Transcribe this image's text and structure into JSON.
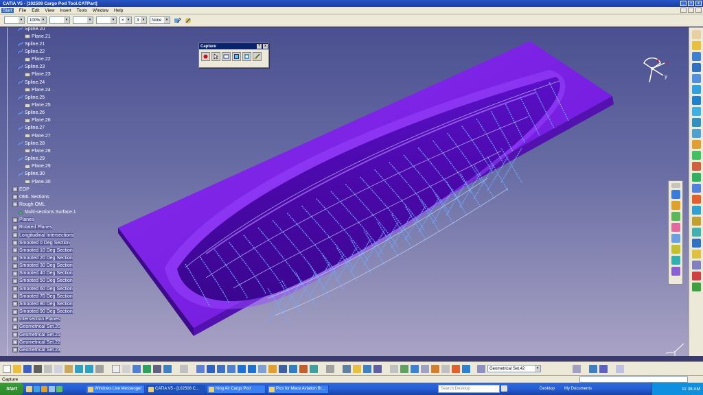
{
  "window": {
    "title": "CATIA V5 - [102508 Cargo Pod Tool.CATPart]"
  },
  "menu": [
    "Start",
    "File",
    "Edit",
    "View",
    "Insert",
    "Tools",
    "Window",
    "Help"
  ],
  "toolbar_top": {
    "zoom": "100%",
    "layer": "None",
    "thickness": "3"
  },
  "tree": [
    {
      "label": "Spline.20",
      "level": 2,
      "icon": "spline"
    },
    {
      "label": "Plane.21",
      "level": 3,
      "icon": "plane"
    },
    {
      "label": "Spline.21",
      "level": 2,
      "icon": "spline"
    },
    {
      "label": "Spline.22",
      "level": 2,
      "icon": "spline"
    },
    {
      "label": "Plane.22",
      "level": 3,
      "icon": "plane"
    },
    {
      "label": "Spline.23",
      "level": 2,
      "icon": "spline"
    },
    {
      "label": "Plane.23",
      "level": 3,
      "icon": "plane"
    },
    {
      "label": "Spline.24",
      "level": 2,
      "icon": "spline"
    },
    {
      "label": "Plane.24",
      "level": 3,
      "icon": "plane"
    },
    {
      "label": "Spline.25",
      "level": 2,
      "icon": "spline"
    },
    {
      "label": "Plane.25",
      "level": 3,
      "icon": "plane"
    },
    {
      "label": "Spline.26",
      "level": 2,
      "icon": "spline"
    },
    {
      "label": "Plane.26",
      "level": 3,
      "icon": "plane"
    },
    {
      "label": "Spline.27",
      "level": 2,
      "icon": "spline"
    },
    {
      "label": "Plane.27",
      "level": 3,
      "icon": "plane"
    },
    {
      "label": "Spline.28",
      "level": 2,
      "icon": "spline"
    },
    {
      "label": "Plane.28",
      "level": 3,
      "icon": "plane"
    },
    {
      "label": "Spline.29",
      "level": 2,
      "icon": "spline"
    },
    {
      "label": "Plane.29",
      "level": 3,
      "icon": "plane"
    },
    {
      "label": "Spline.30",
      "level": 2,
      "icon": "spline"
    },
    {
      "label": "Plane.30",
      "level": 3,
      "icon": "plane"
    },
    {
      "label": "EOP",
      "level": 1,
      "icon": "set"
    },
    {
      "label": "OML Sections",
      "level": 1,
      "icon": "set"
    },
    {
      "label": "Rough OML",
      "level": 1,
      "icon": "set"
    },
    {
      "label": "Multi-sections Surface.1",
      "level": 2,
      "icon": "surface"
    },
    {
      "label": "Planes",
      "level": 1,
      "icon": "set",
      "selected": true
    },
    {
      "label": "Rotated Planes",
      "level": 1,
      "icon": "set",
      "selected": true
    },
    {
      "label": "Longitudinal Intersections",
      "level": 1,
      "icon": "set",
      "selected": true
    },
    {
      "label": "Smooted 0 Deg Section",
      "level": 1,
      "icon": "set",
      "selected": true
    },
    {
      "label": "Smooted 10 Deg Section",
      "level": 1,
      "icon": "set",
      "selected": true
    },
    {
      "label": "Smooted 20 Deg Section",
      "level": 1,
      "icon": "set",
      "selected": true
    },
    {
      "label": "Smooted 30 Deg Section",
      "level": 1,
      "icon": "set",
      "selected": true
    },
    {
      "label": "Smooted 40 Deg Section",
      "level": 1,
      "icon": "set",
      "selected": true
    },
    {
      "label": "Smooted 50 Deg Section",
      "level": 1,
      "icon": "set",
      "selected": true
    },
    {
      "label": "Smooted 60 Deg Section",
      "level": 1,
      "icon": "set",
      "selected": true
    },
    {
      "label": "Smooted 70 Deg Section",
      "level": 1,
      "icon": "set",
      "selected": true
    },
    {
      "label": "Smooted 80 Deg Section",
      "level": 1,
      "icon": "set",
      "selected": true
    },
    {
      "label": "Smooted 90 Deg Section",
      "level": 1,
      "icon": "set",
      "selected": true
    },
    {
      "label": "Intersection Planes",
      "level": 1,
      "icon": "set",
      "selected": true
    },
    {
      "label": "Geometrical Set.20",
      "level": 1,
      "icon": "set",
      "selected": true
    },
    {
      "label": "Geometrical Set.21",
      "level": 1,
      "icon": "set",
      "selected": true
    },
    {
      "label": "Geometrical Set.22",
      "level": 1,
      "icon": "set",
      "selected": true
    },
    {
      "label": "Geometrical Set.23",
      "level": 1,
      "icon": "set",
      "selected": true
    }
  ],
  "capture_toolbar": {
    "title": "Capture",
    "help": "?",
    "close": "x"
  },
  "compass": {
    "x_label": "x",
    "y_label": "y"
  },
  "bottom_toolbar": {
    "geometry_set": "Geometrical Set.42"
  },
  "status": {
    "text": "Capture"
  },
  "taskbar": {
    "start_label": "Start",
    "tasks": [
      {
        "label": "Windows Live Messenger",
        "active": false
      },
      {
        "label": "CATIA V5 - [102508 C...",
        "active": true
      },
      {
        "label": "King Air Cargo Pod",
        "active": false
      },
      {
        "label": "Pics for Mace Aviation Br...",
        "active": false
      }
    ],
    "search_placeholder": "Search Desktop",
    "desktop_label": "Desktop",
    "my_documents_label": "My Documents",
    "clock": "11:38 AM"
  },
  "colors": {
    "part": "#7a1ee0",
    "part_dark": "#4a0aa0",
    "viewport_top": "#4a4f90",
    "viewport_bottom": "#a9a3c4",
    "wire": "#6fa8ff"
  }
}
